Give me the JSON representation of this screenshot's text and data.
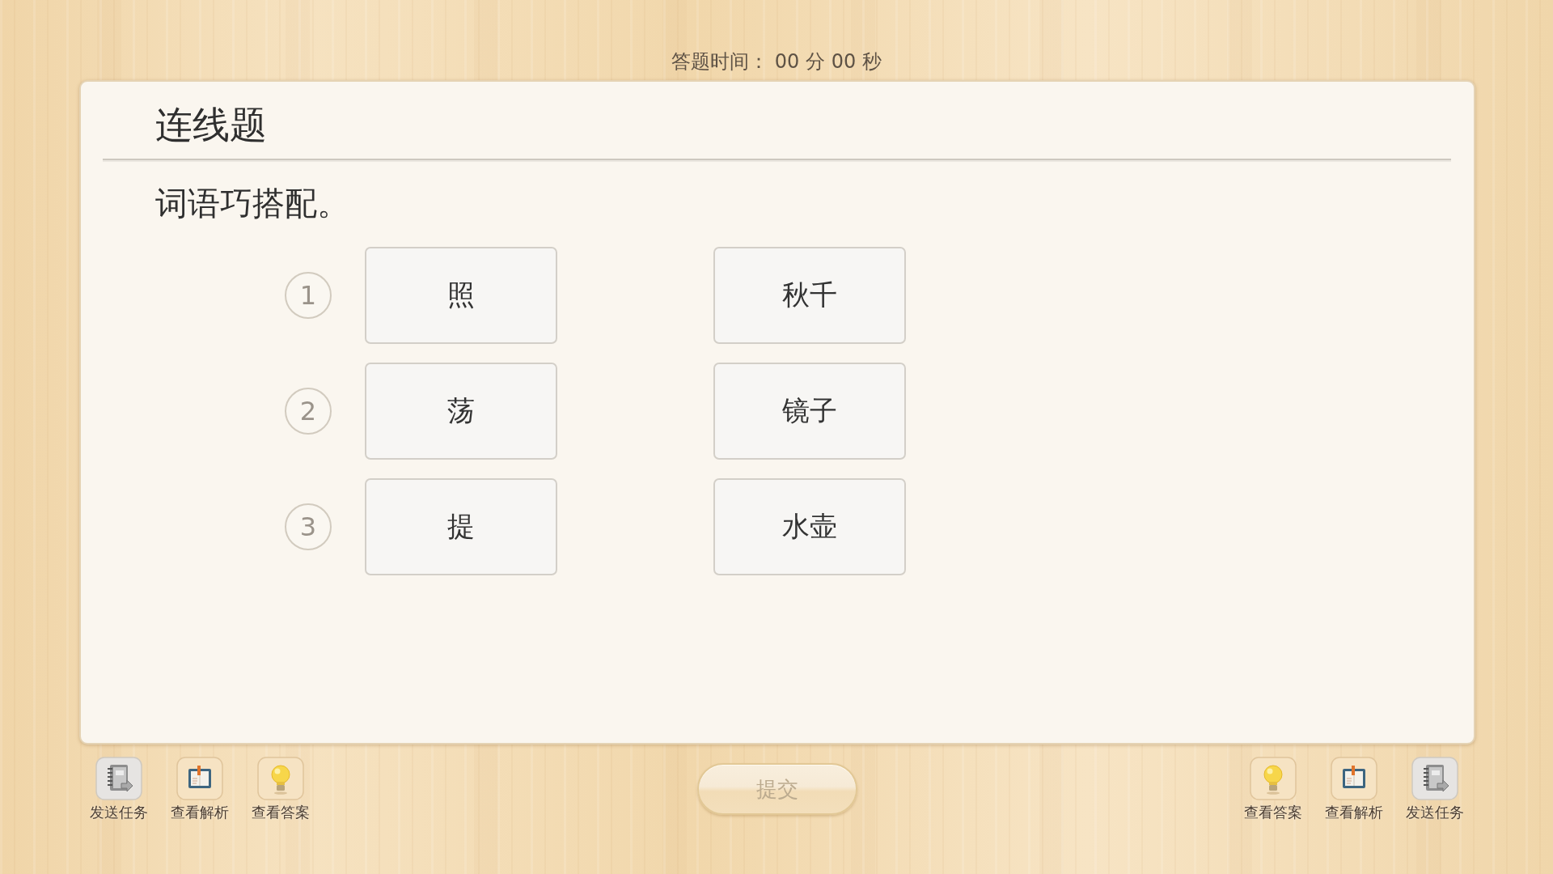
{
  "timer": {
    "text": "答题时间： 00 分 00 秒"
  },
  "question": {
    "type_title": "连线题",
    "prompt": "词语巧搭配。",
    "rows": [
      {
        "number": "1",
        "left": "照",
        "right": "秋千"
      },
      {
        "number": "2",
        "left": "荡",
        "right": "镜子"
      },
      {
        "number": "3",
        "left": "提",
        "right": "水壶"
      }
    ]
  },
  "left_toolbar": [
    {
      "kind": "send",
      "label": "发送任务"
    },
    {
      "kind": "analysis",
      "label": "查看解析"
    },
    {
      "kind": "answer",
      "label": "查看答案"
    }
  ],
  "submit_button": {
    "label": "提交",
    "disabled": true
  },
  "right_toolbar": [
    {
      "kind": "answer",
      "label": "查看答案"
    },
    {
      "kind": "analysis",
      "label": "查看解析"
    },
    {
      "kind": "send",
      "label": "发送任务"
    }
  ]
}
